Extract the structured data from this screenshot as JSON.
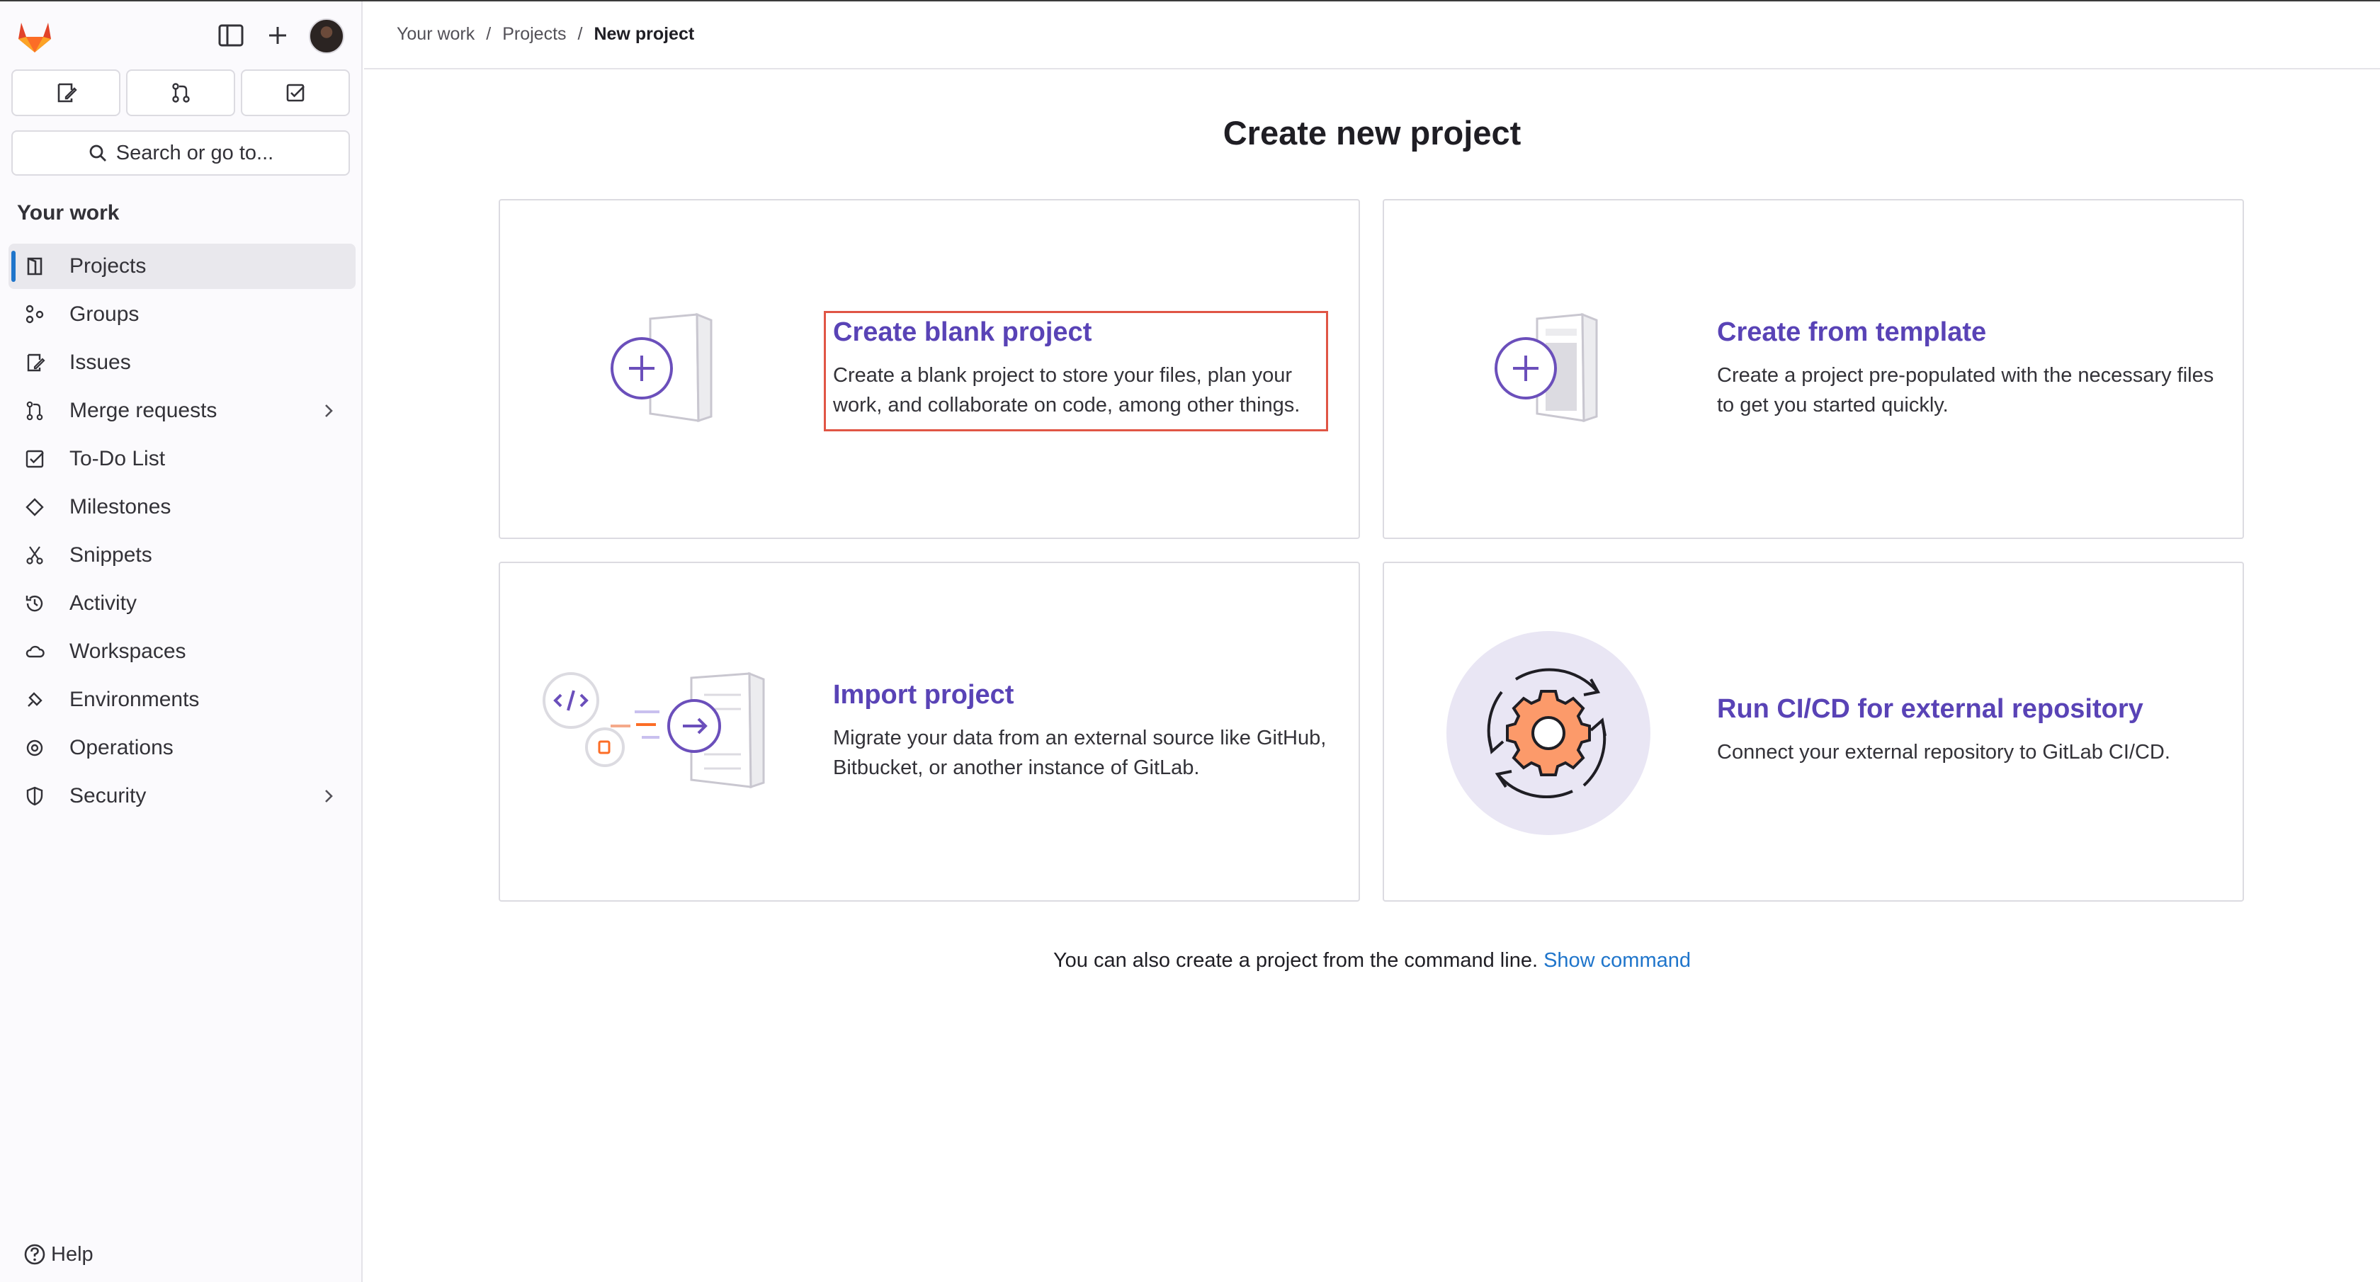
{
  "sidebar": {
    "search_label": "Search or go to...",
    "section_title": "Your work",
    "items": [
      {
        "label": "Projects",
        "icon": "project-icon",
        "active": true
      },
      {
        "label": "Groups",
        "icon": "group-icon"
      },
      {
        "label": "Issues",
        "icon": "issues-icon"
      },
      {
        "label": "Merge requests",
        "icon": "merge-request-icon",
        "expandable": true
      },
      {
        "label": "To-Do List",
        "icon": "todo-icon"
      },
      {
        "label": "Milestones",
        "icon": "milestone-icon"
      },
      {
        "label": "Snippets",
        "icon": "snippet-icon"
      },
      {
        "label": "Activity",
        "icon": "history-icon"
      },
      {
        "label": "Workspaces",
        "icon": "cloud-icon"
      },
      {
        "label": "Environments",
        "icon": "environment-icon"
      },
      {
        "label": "Operations",
        "icon": "operations-icon"
      },
      {
        "label": "Security",
        "icon": "shield-icon",
        "expandable": true
      }
    ],
    "help_label": "Help"
  },
  "breadcrumb": {
    "items": [
      "Your work",
      "Projects",
      "New project"
    ],
    "separator": "/"
  },
  "main": {
    "title": "Create new project",
    "cards": [
      {
        "title": "Create blank project",
        "description": "Create a blank project to store your files, plan your work, and collaborate on code, among other things."
      },
      {
        "title": "Create from template",
        "description": "Create a project pre-populated with the necessary files to get you started quickly."
      },
      {
        "title": "Import project",
        "description": "Migrate your data from an external source like GitHub, Bitbucket, or another instance of GitLab."
      },
      {
        "title": "Run CI/CD for external repository",
        "description": "Connect your external repository to GitLab CI/CD."
      }
    ],
    "footer_text": "You can also create a project from the command line.",
    "footer_link": "Show command"
  },
  "colors": {
    "accent_purple": "#5943b6",
    "link_blue": "#1f75cb",
    "highlight_red": "#e05545"
  }
}
